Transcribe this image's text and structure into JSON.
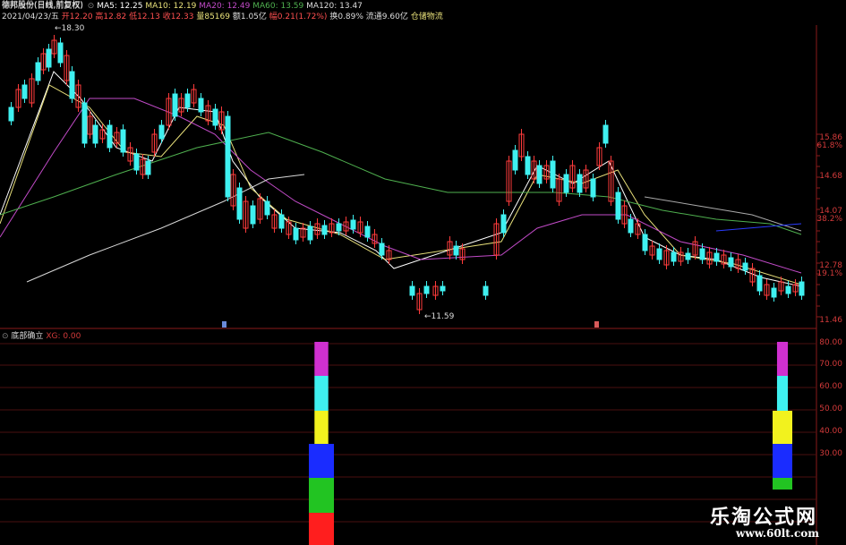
{
  "header": {
    "row0": "德邦股份(日线,前复权)",
    "row1": {
      "ma5": "MA5: 12.25",
      "ma10": "MA10: 12.19",
      "ma20": "MA20: 12.49",
      "ma60": "MA60: 13.59",
      "ma120": "MA120: 13.47"
    },
    "row2": {
      "date": "2021/04/23/五",
      "open": "开12.20",
      "high": "高12.82",
      "low": "低12.13",
      "close": "收12.33",
      "vol": "量85169",
      "amount": "额1.05亿",
      "change": "幅0.21(1.72%)",
      "turnover": "换0.89%",
      "float": "流通9.60亿",
      "sector": "仓储物流"
    }
  },
  "main_chart": {
    "high_marker": "18.30",
    "low_marker": "11.59",
    "y_labels": [
      {
        "price": "15.86",
        "pct": "61.8%"
      },
      {
        "price": "14.68",
        "pct": ""
      },
      {
        "price": "14.07",
        "pct": "38.2%"
      },
      {
        "price": "12.78",
        "pct": "19.1%"
      },
      {
        "price": "11.46",
        "pct": ""
      }
    ]
  },
  "indicator": {
    "title": "底部确立",
    "param": "XG: 0.00",
    "y_labels": [
      "80.00",
      "70.00",
      "60.00",
      "50.00",
      "40.00",
      "30.00"
    ]
  },
  "colors": {
    "up": "#ff3b3b",
    "down": "#3ff0f0",
    "ma5": "#ffffff",
    "ma10": "#e8e07a",
    "ma20": "#c24bc8",
    "ma60": "#4fb04f",
    "ma120": "#d8d8d8",
    "ma250": "#2a3cff"
  },
  "watermark": {
    "name": "乐淘公式网",
    "url": "www.60lt.com"
  }
}
